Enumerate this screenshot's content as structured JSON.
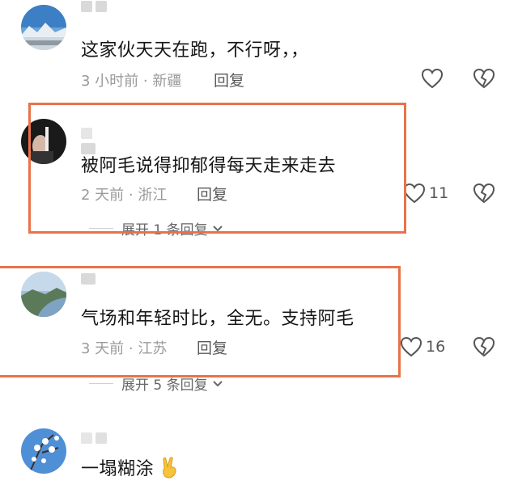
{
  "comments": [
    {
      "text": "这家伙天天在跑，不行呀，，",
      "time": "3 小时前 · 新疆",
      "reply_label": "回复",
      "likes": ""
    },
    {
      "text": "被阿毛说得抑郁得每天走来走去",
      "time": "2 天前 · 浙江",
      "reply_label": "回复",
      "likes": "11",
      "expand_label": "展开 1 条回复"
    },
    {
      "text": "气场和年轻时比，全无。支持阿毛",
      "time": "3 天前 · 江苏",
      "reply_label": "回复",
      "likes": "16",
      "expand_label": "展开 5 条回复"
    },
    {
      "text": "一塌糊涂",
      "emoji": "victory-hand-emoji"
    }
  ],
  "icons": {
    "like": "heart-outline-icon",
    "dislike": "broken-heart-icon",
    "expand": "chevron-down-icon"
  },
  "colors": {
    "highlight_box": "#e8724a",
    "meta_text": "#9a9a9a"
  }
}
